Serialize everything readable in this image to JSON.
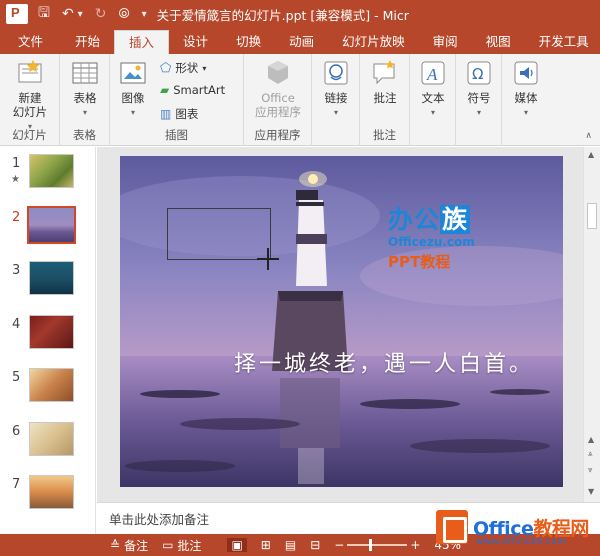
{
  "window": {
    "title": "关于爱情箴言的幻灯片.ppt [兼容模式] - Micr",
    "qat": [
      {
        "icon": "save-icon",
        "glyph": "🖫"
      },
      {
        "icon": "undo-icon",
        "glyph": "↶"
      },
      {
        "icon": "undo-dropdown-icon",
        "glyph": "▾"
      },
      {
        "icon": "redo-icon",
        "glyph": "↻"
      },
      {
        "icon": "present-from-start-icon",
        "glyph": "⦾"
      },
      {
        "icon": "customize-qat-icon",
        "glyph": "▾"
      }
    ]
  },
  "ribbon": {
    "tabs": [
      "文件",
      "开始",
      "插入",
      "设计",
      "切换",
      "动画",
      "幻灯片放映",
      "审阅",
      "视图",
      "开发工具"
    ],
    "active_tab": "插入",
    "groups": {
      "slides": {
        "label": "幻灯片",
        "new_slide": "新建\n幻灯片"
      },
      "tables": {
        "label": "表格",
        "table": "表格"
      },
      "images": {
        "label": "插图",
        "image": "图像",
        "shapes": "形状",
        "smartart": "SmartArt",
        "chart": "图表"
      },
      "apps": {
        "label": "应用程序",
        "office_apps": "Office\n应用程序"
      },
      "links": {
        "link": "链接"
      },
      "comments": {
        "label": "批注",
        "comment": "批注"
      },
      "text": {
        "text": "文本"
      },
      "symbols": {
        "symbol": "符号"
      },
      "media": {
        "media": "媒体"
      }
    }
  },
  "slides_panel": {
    "items": [
      {
        "num": "1",
        "star": "★",
        "theme": "green"
      },
      {
        "num": "2",
        "theme": "lighthouse",
        "selected": true
      },
      {
        "num": "3",
        "theme": "teal"
      },
      {
        "num": "4",
        "theme": "red"
      },
      {
        "num": "5",
        "theme": "warm"
      },
      {
        "num": "6",
        "theme": "beige"
      },
      {
        "num": "7",
        "theme": "sunset"
      }
    ]
  },
  "slide": {
    "quote": "择一城终老，遇一人白首。",
    "logo_main_a": "办公",
    "logo_main_b": "族",
    "logo_url": "Officezu.com",
    "logo_sub": "PPT教程"
  },
  "notes": {
    "placeholder": "单击此处添加备注"
  },
  "statusbar": {
    "notes": "备注",
    "comments": "批注",
    "zoom": "45%"
  },
  "watermark": {
    "brand": "Office",
    "brand_cn": "教程网",
    "sub": "www.office26.com"
  },
  "colors": {
    "accent": "#b7472a",
    "selected_thumb": "#d24726",
    "watermark_orange": "#e85d19",
    "watermark_blue": "#1e6fd9"
  }
}
